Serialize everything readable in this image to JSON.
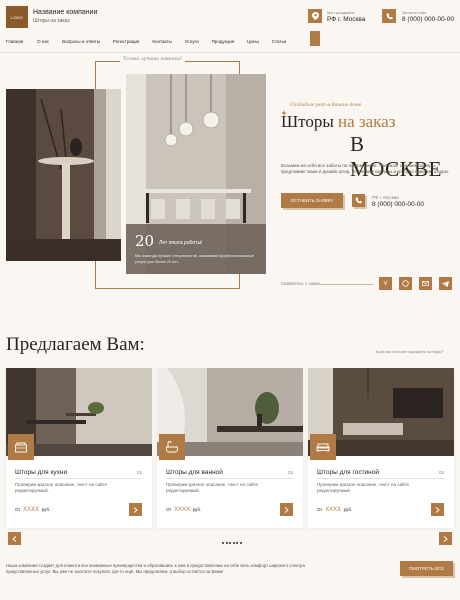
{
  "header": {
    "logo": "LOGO",
    "company_name": "Название компании",
    "company_sub": "Шторы на заказ",
    "location_label": "Мы находимся",
    "location_value": "РФ г. Москва",
    "phone_label": "Звоните нам:",
    "phone_value": "8 (000) 000-00-00"
  },
  "nav": [
    "Главная",
    "О нас",
    "Вопросы и ответы",
    "Регистрация",
    "Контакты",
    "Услуги",
    "Продукция",
    "Цены",
    "Статьи"
  ],
  "hero": {
    "frame_tagline": "Только лучшие новинки!",
    "tagline": "Создадим уют в Вашем доме",
    "title_part1": "Шторы ",
    "title_accent": "на заказ",
    "title_line2": "В МОСКВЕ",
    "description": "Возьмем на себя все заботы по оформлению: текстиля, сделаем замеры, предложим ткани и дизайн штор, установим карнизы и красиво повесим шторы.",
    "order_button": "ОСТАВИТЬ ЗАЯВКУ",
    "phone_label": "РФ г. Москва",
    "phone_value": "8 (000) 000-00-00",
    "stat_number": "20",
    "stat_label": "Лет опыта работы!",
    "stat_desc": "Мы команда лучших специалистов, оказываем профессиональные услуги уже более 20 лет.",
    "social_label": "Свяжитесь с нами:"
  },
  "offers": {
    "title": "Предлагаем Вам:",
    "hint": "Куда вы хотите заказать шторы?",
    "cards": [
      {
        "name": "Шторы для кухни",
        "num": "01",
        "desc": "Проверим краткое описание, текст на сайте редактируемый.",
        "price_prefix": "От",
        "price": "XXXX",
        "price_unit": "руб."
      },
      {
        "name": "Шторы для ванной",
        "num": "02",
        "desc": "Проверим краткое описание, текст на сайте редактируемый.",
        "price_prefix": "От",
        "price": "XXXX",
        "price_unit": "руб."
      },
      {
        "name": "Шторы для гостиной",
        "num": "03",
        "desc": "Проверим краткое описание, текст на сайте редактируемый.",
        "price_prefix": "От",
        "price": "XXXX",
        "price_unit": "руб."
      }
    ],
    "footer_text": "Наша компания создаёт для клиента все возможные преимущества и обратившись к нам в предоставлении на себе весь комфорт широкого спектра представленных услуг. Вы уже не захотите покупать где-то ещё. Мы предлагаем, а выбор остаётся за Вами!",
    "all_button": "СМОТРЕТЬ ВСЕ"
  },
  "colors": {
    "accent": "#b07a45",
    "background": "#faf7f2",
    "text": "#2b2520"
  }
}
